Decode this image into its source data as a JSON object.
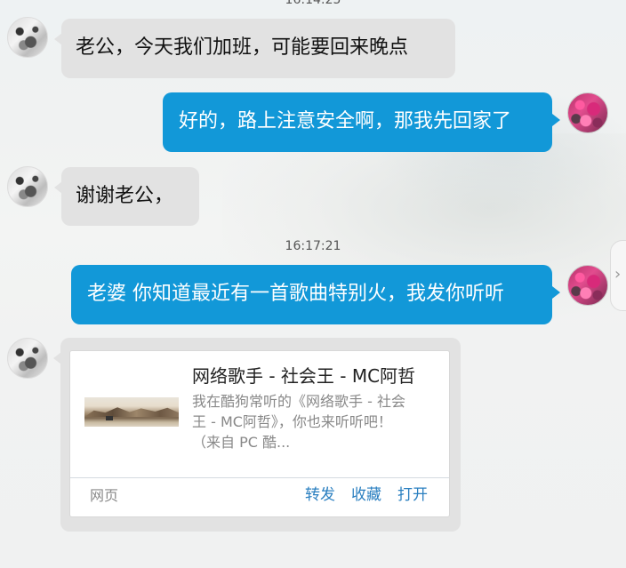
{
  "timestamps": [
    "16:14:25",
    "16:17:21"
  ],
  "messages": [
    {
      "side": "in",
      "text": "老公，今天我们加班，可能要回来晚点"
    },
    {
      "side": "out",
      "text": "好的，路上注意安全啊，那我先回家了"
    },
    {
      "side": "in",
      "text": "谢谢老公，"
    },
    {
      "side": "out",
      "text": "老婆 你知道最近有一首歌曲特别火，我发你听听"
    }
  ],
  "share_card": {
    "title": "网络歌手 - 社会王 - MC阿哲",
    "desc_lines": [
      "我在酷狗常听的《网络歌手 - 社会",
      "王 - MC阿哲》，你也来听听吧！",
      "（来自 PC 酷..."
    ],
    "source_label": "网页",
    "actions": [
      "转发",
      "收藏",
      "打开"
    ]
  },
  "icons": {
    "contact_avatar": "avatar-photo",
    "self_avatar": "avatar-flowers",
    "scroll_handle": "chevron-right-icon"
  },
  "colors": {
    "outgoing_bubble": "#1298d8",
    "incoming_bubble": "#e2e2e2",
    "link": "#2a7fc0"
  }
}
